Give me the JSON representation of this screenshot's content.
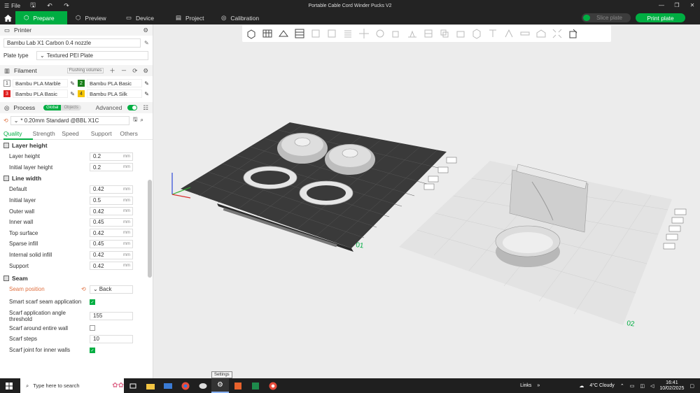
{
  "titlebar": {
    "menu_label": "File",
    "title": "Portable Cable Cord Winder Pucks V2"
  },
  "nav": {
    "tabs": [
      {
        "label": "Prepare",
        "icon": "prepare-icon",
        "active": true
      },
      {
        "label": "Preview",
        "icon": "preview-icon"
      },
      {
        "label": "Device",
        "icon": "device-icon"
      },
      {
        "label": "Project",
        "icon": "project-icon"
      },
      {
        "label": "Calibration",
        "icon": "calibration-icon"
      }
    ],
    "slice_label": "Slice plate",
    "print_label": "Print plate"
  },
  "printer": {
    "section_label": "Printer",
    "name": "Bambu Lab X1 Carbon 0.4 nozzle",
    "plate_type_label": "Plate type",
    "plate_type": "Textured PEI Plate"
  },
  "filament": {
    "section_label": "Filament",
    "flushing_label": "Flushing volumes",
    "items": [
      {
        "num": "1",
        "name": "Bambu PLA Marble",
        "color": "#ffffff"
      },
      {
        "num": "2",
        "name": "Bambu PLA Basic",
        "color": "#1a7f1a"
      },
      {
        "num": "3",
        "name": "Bambu PLA Basic",
        "color": "#e02020"
      },
      {
        "num": "4",
        "name": "Bambu PLA Silk",
        "color": "#f5c400"
      }
    ]
  },
  "process": {
    "section_label": "Process",
    "global_label": "Global",
    "objects_label": "Objects",
    "advanced_label": "Advanced",
    "preset": "* 0.20mm Standard @BBL X1C",
    "tabs": [
      "Quality",
      "Strength",
      "Speed",
      "Support",
      "Others"
    ]
  },
  "layer_height": {
    "title": "Layer height",
    "params": [
      {
        "label": "Layer height",
        "value": "0.2",
        "unit": "mm"
      },
      {
        "label": "Initial layer height",
        "value": "0.2",
        "unit": "mm"
      }
    ]
  },
  "line_width": {
    "title": "Line width",
    "params": [
      {
        "label": "Default",
        "value": "0.42",
        "unit": "mm"
      },
      {
        "label": "Initial layer",
        "value": "0.5",
        "unit": "mm"
      },
      {
        "label": "Outer wall",
        "value": "0.42",
        "unit": "mm"
      },
      {
        "label": "Inner wall",
        "value": "0.45",
        "unit": "mm"
      },
      {
        "label": "Top surface",
        "value": "0.42",
        "unit": "mm"
      },
      {
        "label": "Sparse infill",
        "value": "0.45",
        "unit": "mm"
      },
      {
        "label": "Internal solid infill",
        "value": "0.42",
        "unit": "mm"
      },
      {
        "label": "Support",
        "value": "0.42",
        "unit": "mm"
      }
    ]
  },
  "seam": {
    "title": "Seam",
    "position_label": "Seam position",
    "position_value": "Back",
    "smart_scarf_label": "Smart scarf seam application",
    "angle_label": "Scarf application angle threshold",
    "angle_value": "155",
    "around_label": "Scarf around entire wall",
    "steps_label": "Scarf steps",
    "steps_value": "10",
    "inner_label": "Scarf joint for inner walls"
  },
  "plates": {
    "plate1_label": "01",
    "plate2_label": "02"
  },
  "tooltip": "Settings",
  "taskbar": {
    "search_placeholder": "Type here to search",
    "links_label": "Links",
    "weather": "4°C  Cloudy",
    "time": "16:41",
    "date": "10/02/2025"
  }
}
